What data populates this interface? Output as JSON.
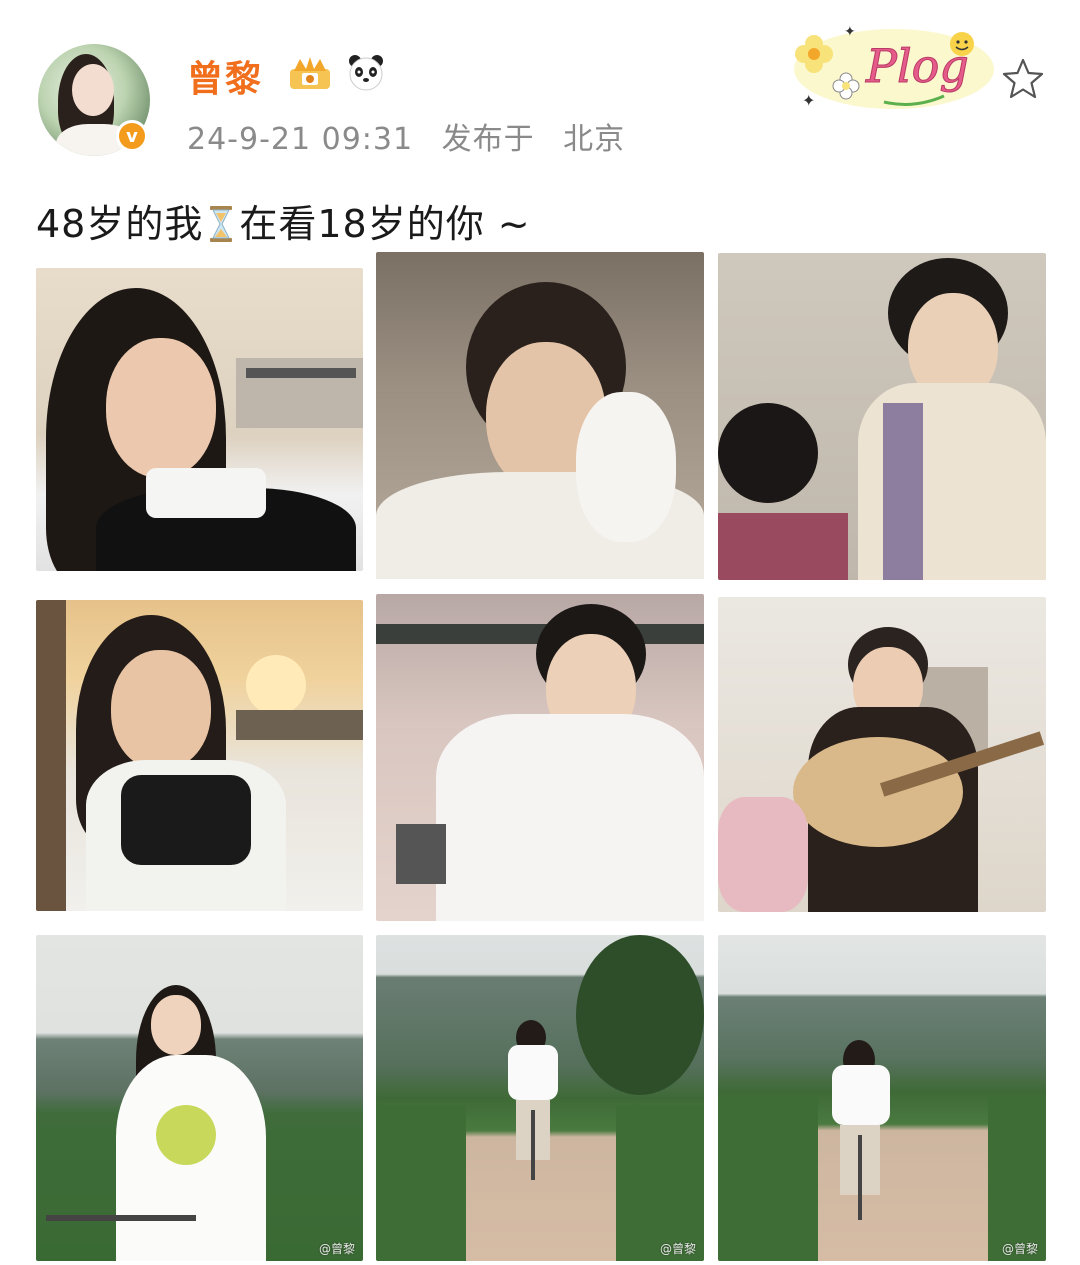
{
  "post": {
    "username": "曾黎",
    "timestamp": "24-9-21 09:31",
    "published_label": "发布于",
    "location": "北京",
    "text_part1": "48岁的我",
    "text_part2": "在看18岁的你 ~",
    "badge_letter": "v",
    "plog_label": "Plog"
  },
  "photos": [
    {
      "watermark": ""
    },
    {
      "watermark": ""
    },
    {
      "watermark": ""
    },
    {
      "watermark": ""
    },
    {
      "watermark": ""
    },
    {
      "watermark": ""
    },
    {
      "watermark": "@曾黎"
    },
    {
      "watermark": "@曾黎"
    },
    {
      "watermark": "@曾黎"
    }
  ],
  "colors": {
    "username": "#f06e1c",
    "meta": "#8a8a8a",
    "badge": "#f29b1c"
  },
  "icons": [
    "crown-icon",
    "panda-icon",
    "star-icon",
    "hourglass-icon",
    "verified-icon"
  ]
}
